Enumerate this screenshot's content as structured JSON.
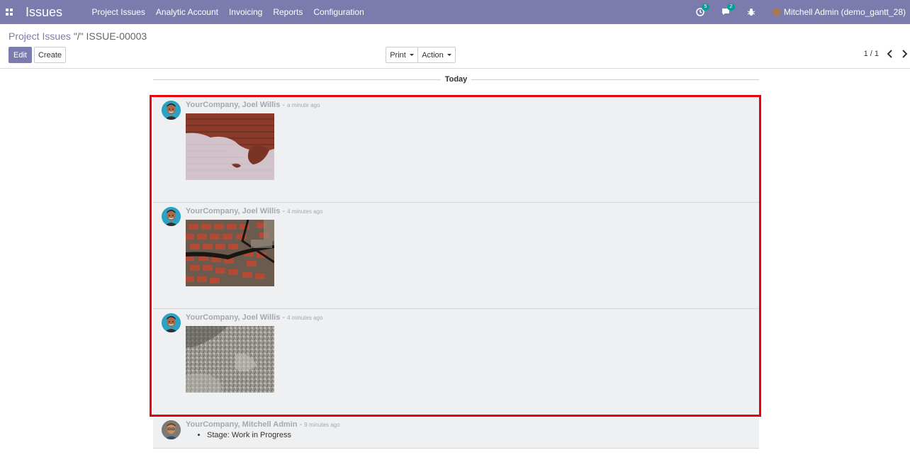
{
  "navbar": {
    "app_name": "Issues",
    "menu": [
      "Project Issues",
      "Analytic Account",
      "Invoicing",
      "Reports",
      "Configuration"
    ],
    "activity_count": "5",
    "message_count": "2",
    "user_name": "Mitchell Admin (demo_gantt_28)",
    "icons": [
      "apps-icon",
      "clock-icon",
      "chat-icon",
      "bug-icon"
    ]
  },
  "breadcrumb": {
    "parent": "Project Issues",
    "current": "\"/\" ISSUE-00003"
  },
  "buttons": {
    "edit": "Edit",
    "create": "Create",
    "print": "Print",
    "action": "Action"
  },
  "pager": {
    "value": "1 / 1"
  },
  "chatter": {
    "date_label": "Today",
    "messages": [
      {
        "author": "YourCompany, Joel Willis",
        "date": "a minute ago",
        "attachment": "red-brick-wall-with-white-paint"
      },
      {
        "author": "YourCompany, Joel Willis",
        "date": "4 minutes ago",
        "attachment": "cracked-brick-pavement"
      },
      {
        "author": "YourCompany, Joel Willis",
        "date": "4 minutes ago",
        "attachment": "grey-stone-texture"
      },
      {
        "author": "YourCompany, Mitchell Admin",
        "date": "9 minutes ago",
        "tracking": "Stage: Work in Progress"
      }
    ]
  },
  "colors": {
    "navbar": "#7c7bad",
    "message_bg": "#eff0f2",
    "highlight": "#e8000b",
    "badge": "#00a09d"
  }
}
